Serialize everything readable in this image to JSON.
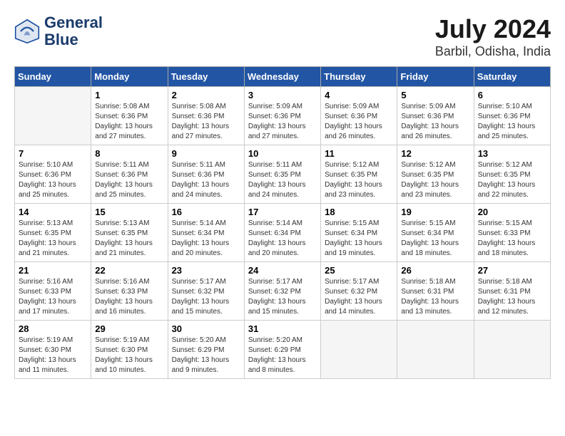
{
  "header": {
    "logo_line1": "General",
    "logo_line2": "Blue",
    "month": "July 2024",
    "location": "Barbil, Odisha, India"
  },
  "days_of_week": [
    "Sunday",
    "Monday",
    "Tuesday",
    "Wednesday",
    "Thursday",
    "Friday",
    "Saturday"
  ],
  "weeks": [
    [
      {
        "day": "",
        "empty": true
      },
      {
        "day": "1",
        "sunrise": "Sunrise: 5:08 AM",
        "sunset": "Sunset: 6:36 PM",
        "daylight": "Daylight: 13 hours and 27 minutes."
      },
      {
        "day": "2",
        "sunrise": "Sunrise: 5:08 AM",
        "sunset": "Sunset: 6:36 PM",
        "daylight": "Daylight: 13 hours and 27 minutes."
      },
      {
        "day": "3",
        "sunrise": "Sunrise: 5:09 AM",
        "sunset": "Sunset: 6:36 PM",
        "daylight": "Daylight: 13 hours and 27 minutes."
      },
      {
        "day": "4",
        "sunrise": "Sunrise: 5:09 AM",
        "sunset": "Sunset: 6:36 PM",
        "daylight": "Daylight: 13 hours and 26 minutes."
      },
      {
        "day": "5",
        "sunrise": "Sunrise: 5:09 AM",
        "sunset": "Sunset: 6:36 PM",
        "daylight": "Daylight: 13 hours and 26 minutes."
      },
      {
        "day": "6",
        "sunrise": "Sunrise: 5:10 AM",
        "sunset": "Sunset: 6:36 PM",
        "daylight": "Daylight: 13 hours and 25 minutes."
      }
    ],
    [
      {
        "day": "7",
        "sunrise": "Sunrise: 5:10 AM",
        "sunset": "Sunset: 6:36 PM",
        "daylight": "Daylight: 13 hours and 25 minutes."
      },
      {
        "day": "8",
        "sunrise": "Sunrise: 5:11 AM",
        "sunset": "Sunset: 6:36 PM",
        "daylight": "Daylight: 13 hours and 25 minutes."
      },
      {
        "day": "9",
        "sunrise": "Sunrise: 5:11 AM",
        "sunset": "Sunset: 6:36 PM",
        "daylight": "Daylight: 13 hours and 24 minutes."
      },
      {
        "day": "10",
        "sunrise": "Sunrise: 5:11 AM",
        "sunset": "Sunset: 6:35 PM",
        "daylight": "Daylight: 13 hours and 24 minutes."
      },
      {
        "day": "11",
        "sunrise": "Sunrise: 5:12 AM",
        "sunset": "Sunset: 6:35 PM",
        "daylight": "Daylight: 13 hours and 23 minutes."
      },
      {
        "day": "12",
        "sunrise": "Sunrise: 5:12 AM",
        "sunset": "Sunset: 6:35 PM",
        "daylight": "Daylight: 13 hours and 23 minutes."
      },
      {
        "day": "13",
        "sunrise": "Sunrise: 5:12 AM",
        "sunset": "Sunset: 6:35 PM",
        "daylight": "Daylight: 13 hours and 22 minutes."
      }
    ],
    [
      {
        "day": "14",
        "sunrise": "Sunrise: 5:13 AM",
        "sunset": "Sunset: 6:35 PM",
        "daylight": "Daylight: 13 hours and 21 minutes."
      },
      {
        "day": "15",
        "sunrise": "Sunrise: 5:13 AM",
        "sunset": "Sunset: 6:35 PM",
        "daylight": "Daylight: 13 hours and 21 minutes."
      },
      {
        "day": "16",
        "sunrise": "Sunrise: 5:14 AM",
        "sunset": "Sunset: 6:34 PM",
        "daylight": "Daylight: 13 hours and 20 minutes."
      },
      {
        "day": "17",
        "sunrise": "Sunrise: 5:14 AM",
        "sunset": "Sunset: 6:34 PM",
        "daylight": "Daylight: 13 hours and 20 minutes."
      },
      {
        "day": "18",
        "sunrise": "Sunrise: 5:15 AM",
        "sunset": "Sunset: 6:34 PM",
        "daylight": "Daylight: 13 hours and 19 minutes."
      },
      {
        "day": "19",
        "sunrise": "Sunrise: 5:15 AM",
        "sunset": "Sunset: 6:34 PM",
        "daylight": "Daylight: 13 hours and 18 minutes."
      },
      {
        "day": "20",
        "sunrise": "Sunrise: 5:15 AM",
        "sunset": "Sunset: 6:33 PM",
        "daylight": "Daylight: 13 hours and 18 minutes."
      }
    ],
    [
      {
        "day": "21",
        "sunrise": "Sunrise: 5:16 AM",
        "sunset": "Sunset: 6:33 PM",
        "daylight": "Daylight: 13 hours and 17 minutes."
      },
      {
        "day": "22",
        "sunrise": "Sunrise: 5:16 AM",
        "sunset": "Sunset: 6:33 PM",
        "daylight": "Daylight: 13 hours and 16 minutes."
      },
      {
        "day": "23",
        "sunrise": "Sunrise: 5:17 AM",
        "sunset": "Sunset: 6:32 PM",
        "daylight": "Daylight: 13 hours and 15 minutes."
      },
      {
        "day": "24",
        "sunrise": "Sunrise: 5:17 AM",
        "sunset": "Sunset: 6:32 PM",
        "daylight": "Daylight: 13 hours and 15 minutes."
      },
      {
        "day": "25",
        "sunrise": "Sunrise: 5:17 AM",
        "sunset": "Sunset: 6:32 PM",
        "daylight": "Daylight: 13 hours and 14 minutes."
      },
      {
        "day": "26",
        "sunrise": "Sunrise: 5:18 AM",
        "sunset": "Sunset: 6:31 PM",
        "daylight": "Daylight: 13 hours and 13 minutes."
      },
      {
        "day": "27",
        "sunrise": "Sunrise: 5:18 AM",
        "sunset": "Sunset: 6:31 PM",
        "daylight": "Daylight: 13 hours and 12 minutes."
      }
    ],
    [
      {
        "day": "28",
        "sunrise": "Sunrise: 5:19 AM",
        "sunset": "Sunset: 6:30 PM",
        "daylight": "Daylight: 13 hours and 11 minutes."
      },
      {
        "day": "29",
        "sunrise": "Sunrise: 5:19 AM",
        "sunset": "Sunset: 6:30 PM",
        "daylight": "Daylight: 13 hours and 10 minutes."
      },
      {
        "day": "30",
        "sunrise": "Sunrise: 5:20 AM",
        "sunset": "Sunset: 6:29 PM",
        "daylight": "Daylight: 13 hours and 9 minutes."
      },
      {
        "day": "31",
        "sunrise": "Sunrise: 5:20 AM",
        "sunset": "Sunset: 6:29 PM",
        "daylight": "Daylight: 13 hours and 8 minutes."
      },
      {
        "day": "",
        "empty": true
      },
      {
        "day": "",
        "empty": true
      },
      {
        "day": "",
        "empty": true
      }
    ]
  ]
}
